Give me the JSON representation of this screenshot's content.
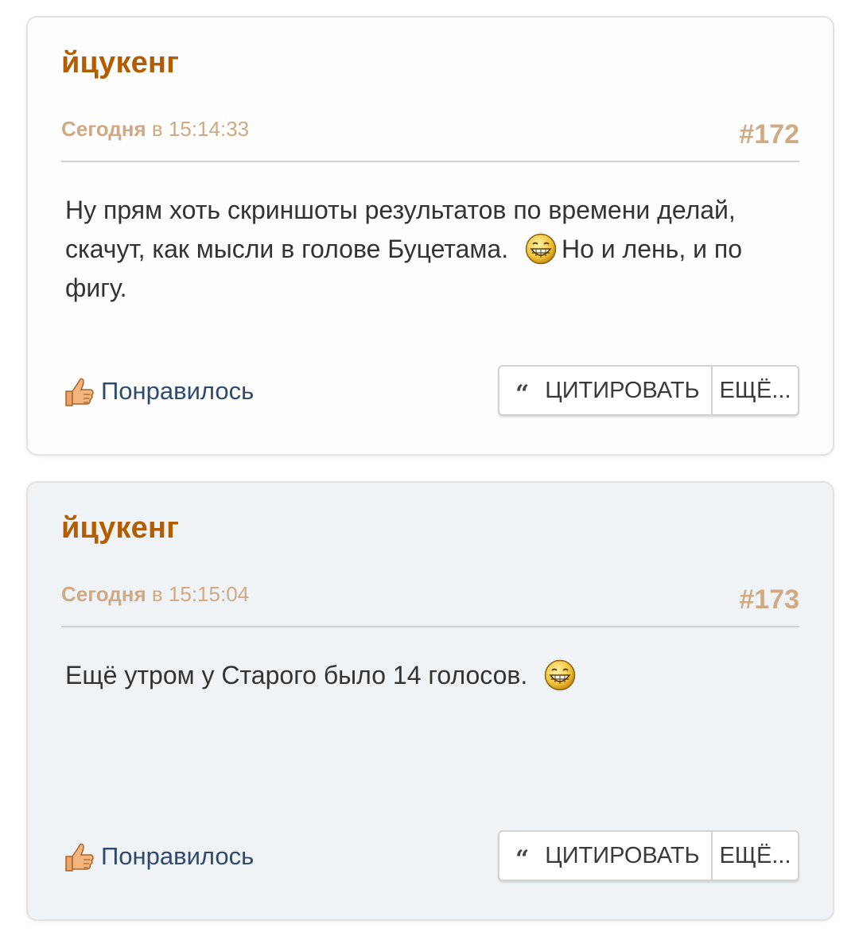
{
  "posts": [
    {
      "author": "йцукенг",
      "date_day": "Сегодня",
      "date_rest": " в 15:14:33",
      "number": "#172",
      "body_before": "Ну прям хоть скриншоты результатов по времени делай, скачут, как мысли в голове Буцетама.",
      "body_after": "Но и лень, и по фигу.",
      "smiley_icon": "grin-smiley-icon",
      "like_label": "Понравилось",
      "quote_label": "ЦИТИРОВАТЬ",
      "more_label": "ЕЩЁ..."
    },
    {
      "author": "йцукенг",
      "date_day": "Сегодня",
      "date_rest": " в 15:15:04",
      "number": "#173",
      "body_before": "Ещё утром у Старого было 14 голосов.",
      "body_after": "",
      "smiley_icon": "grin-smiley-icon",
      "like_label": "Понравилось",
      "quote_label": "ЦИТИРОВАТЬ",
      "more_label": "ЕЩЁ..."
    }
  ],
  "colors": {
    "author": "#b35c00",
    "meta": "#cfaa84",
    "like": "#2f4a6e",
    "post_bg_alt": "#f0f3f6"
  }
}
